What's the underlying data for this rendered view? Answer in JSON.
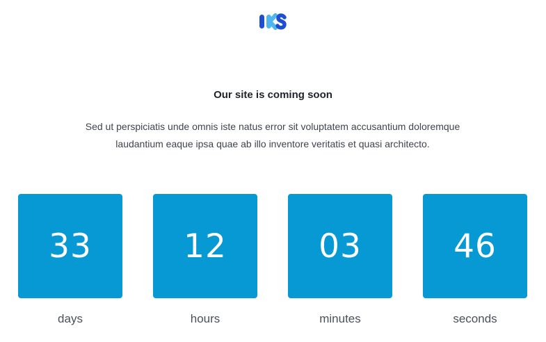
{
  "brand": {
    "logo_text": "IKS",
    "colors": {
      "primary": "#1f4fd1",
      "secondary": "#4fb6f0"
    }
  },
  "heading": "Our site is coming soon",
  "description_line1": "Sed ut perspiciatis unde omnis iste natus error sit voluptatem accusantium doloremque",
  "description_line2": "laudantium eaque ipsa quae ab illo inventore veritatis et quasi architecto.",
  "countdown": {
    "accent_color": "#0799d3",
    "units": [
      {
        "value": "33",
        "label": "days"
      },
      {
        "value": "12",
        "label": "hours"
      },
      {
        "value": "03",
        "label": "minutes"
      },
      {
        "value": "46",
        "label": "seconds"
      }
    ]
  }
}
